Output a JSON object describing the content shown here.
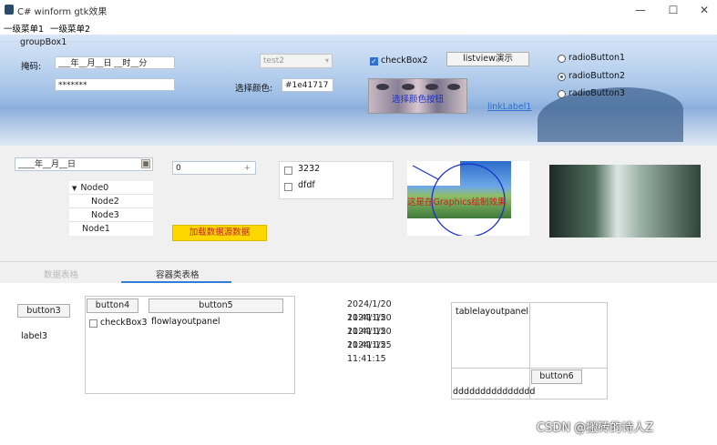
{
  "window": {
    "title": "C# winform gtk效果",
    "minimize": "—",
    "maximize": "☐",
    "close": "✕"
  },
  "menu": {
    "items": [
      "一级菜单1",
      "一级菜单2"
    ]
  },
  "groupbox": {
    "title": "groupBox1",
    "mask_label": "掩码:",
    "masked_value": "___年__月__日 __时__分",
    "password_value": "*******",
    "combo_value": "test2",
    "color_label": "选择颜色:",
    "color_value": "#1e41717",
    "checkbox_label": "checkBox2",
    "listview_button": "listview演示",
    "color_button": "选择颜色按钮",
    "link_label": "linkLabel1",
    "radios": [
      "radioButton1",
      "radioButton2",
      "radioButton3"
    ],
    "radio_selected": 1
  },
  "middle": {
    "date_mask": "____年__月__日",
    "tree": {
      "root": "Node0",
      "children": [
        "Node2",
        "Node3"
      ],
      "sibling": "Node1"
    },
    "numeric_value": "0",
    "load_button": "加载数据源数据",
    "checklist": [
      "3232",
      "dfdf"
    ],
    "graphics_text": "这是在Graphics绘制效果"
  },
  "tabs": {
    "items": [
      "数据表格",
      "容器类表格"
    ],
    "active": 1
  },
  "tab2": {
    "button3": "button3",
    "label3": "label3",
    "button4": "button4",
    "button5": "button5",
    "checkbox3": "checkBox3",
    "flow_label": "flowlayoutpanel",
    "dates": [
      "2024/1/20 11:41:15",
      "2024/1/20 11:41:15",
      "2024/1/20 11:41:15",
      "2024/1/25 11:41:15"
    ],
    "table_label": "tablelayoutpanel",
    "table_text": "ddddddddddddddd",
    "button6": "button6"
  },
  "watermark": "CSDN @搬砖的诗人Z",
  "colors": {
    "accent": "#2f7fd8",
    "load_button_bg": "#ffd700",
    "link": "#2a6fd0",
    "graphics_text": "#d01a1a",
    "circle": "#1a2fd0"
  }
}
